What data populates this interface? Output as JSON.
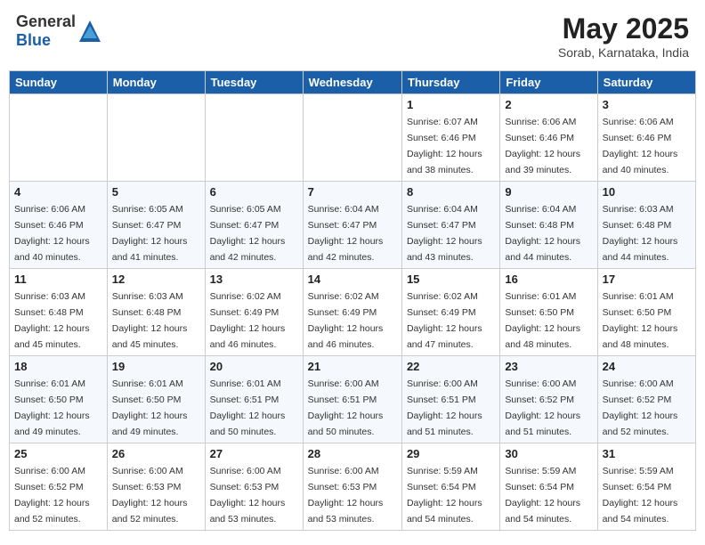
{
  "header": {
    "logo_general": "General",
    "logo_blue": "Blue",
    "month_year": "May 2025",
    "location": "Sorab, Karnataka, India"
  },
  "weekdays": [
    "Sunday",
    "Monday",
    "Tuesday",
    "Wednesday",
    "Thursday",
    "Friday",
    "Saturday"
  ],
  "weeks": [
    [
      {
        "day": "",
        "sunrise": "",
        "sunset": "",
        "daylight": ""
      },
      {
        "day": "",
        "sunrise": "",
        "sunset": "",
        "daylight": ""
      },
      {
        "day": "",
        "sunrise": "",
        "sunset": "",
        "daylight": ""
      },
      {
        "day": "",
        "sunrise": "",
        "sunset": "",
        "daylight": ""
      },
      {
        "day": "1",
        "sunrise": "Sunrise: 6:07 AM",
        "sunset": "Sunset: 6:46 PM",
        "daylight": "Daylight: 12 hours and 38 minutes."
      },
      {
        "day": "2",
        "sunrise": "Sunrise: 6:06 AM",
        "sunset": "Sunset: 6:46 PM",
        "daylight": "Daylight: 12 hours and 39 minutes."
      },
      {
        "day": "3",
        "sunrise": "Sunrise: 6:06 AM",
        "sunset": "Sunset: 6:46 PM",
        "daylight": "Daylight: 12 hours and 40 minutes."
      }
    ],
    [
      {
        "day": "4",
        "sunrise": "Sunrise: 6:06 AM",
        "sunset": "Sunset: 6:46 PM",
        "daylight": "Daylight: 12 hours and 40 minutes."
      },
      {
        "day": "5",
        "sunrise": "Sunrise: 6:05 AM",
        "sunset": "Sunset: 6:47 PM",
        "daylight": "Daylight: 12 hours and 41 minutes."
      },
      {
        "day": "6",
        "sunrise": "Sunrise: 6:05 AM",
        "sunset": "Sunset: 6:47 PM",
        "daylight": "Daylight: 12 hours and 42 minutes."
      },
      {
        "day": "7",
        "sunrise": "Sunrise: 6:04 AM",
        "sunset": "Sunset: 6:47 PM",
        "daylight": "Daylight: 12 hours and 42 minutes."
      },
      {
        "day": "8",
        "sunrise": "Sunrise: 6:04 AM",
        "sunset": "Sunset: 6:47 PM",
        "daylight": "Daylight: 12 hours and 43 minutes."
      },
      {
        "day": "9",
        "sunrise": "Sunrise: 6:04 AM",
        "sunset": "Sunset: 6:48 PM",
        "daylight": "Daylight: 12 hours and 44 minutes."
      },
      {
        "day": "10",
        "sunrise": "Sunrise: 6:03 AM",
        "sunset": "Sunset: 6:48 PM",
        "daylight": "Daylight: 12 hours and 44 minutes."
      }
    ],
    [
      {
        "day": "11",
        "sunrise": "Sunrise: 6:03 AM",
        "sunset": "Sunset: 6:48 PM",
        "daylight": "Daylight: 12 hours and 45 minutes."
      },
      {
        "day": "12",
        "sunrise": "Sunrise: 6:03 AM",
        "sunset": "Sunset: 6:48 PM",
        "daylight": "Daylight: 12 hours and 45 minutes."
      },
      {
        "day": "13",
        "sunrise": "Sunrise: 6:02 AM",
        "sunset": "Sunset: 6:49 PM",
        "daylight": "Daylight: 12 hours and 46 minutes."
      },
      {
        "day": "14",
        "sunrise": "Sunrise: 6:02 AM",
        "sunset": "Sunset: 6:49 PM",
        "daylight": "Daylight: 12 hours and 46 minutes."
      },
      {
        "day": "15",
        "sunrise": "Sunrise: 6:02 AM",
        "sunset": "Sunset: 6:49 PM",
        "daylight": "Daylight: 12 hours and 47 minutes."
      },
      {
        "day": "16",
        "sunrise": "Sunrise: 6:01 AM",
        "sunset": "Sunset: 6:50 PM",
        "daylight": "Daylight: 12 hours and 48 minutes."
      },
      {
        "day": "17",
        "sunrise": "Sunrise: 6:01 AM",
        "sunset": "Sunset: 6:50 PM",
        "daylight": "Daylight: 12 hours and 48 minutes."
      }
    ],
    [
      {
        "day": "18",
        "sunrise": "Sunrise: 6:01 AM",
        "sunset": "Sunset: 6:50 PM",
        "daylight": "Daylight: 12 hours and 49 minutes."
      },
      {
        "day": "19",
        "sunrise": "Sunrise: 6:01 AM",
        "sunset": "Sunset: 6:50 PM",
        "daylight": "Daylight: 12 hours and 49 minutes."
      },
      {
        "day": "20",
        "sunrise": "Sunrise: 6:01 AM",
        "sunset": "Sunset: 6:51 PM",
        "daylight": "Daylight: 12 hours and 50 minutes."
      },
      {
        "day": "21",
        "sunrise": "Sunrise: 6:00 AM",
        "sunset": "Sunset: 6:51 PM",
        "daylight": "Daylight: 12 hours and 50 minutes."
      },
      {
        "day": "22",
        "sunrise": "Sunrise: 6:00 AM",
        "sunset": "Sunset: 6:51 PM",
        "daylight": "Daylight: 12 hours and 51 minutes."
      },
      {
        "day": "23",
        "sunrise": "Sunrise: 6:00 AM",
        "sunset": "Sunset: 6:52 PM",
        "daylight": "Daylight: 12 hours and 51 minutes."
      },
      {
        "day": "24",
        "sunrise": "Sunrise: 6:00 AM",
        "sunset": "Sunset: 6:52 PM",
        "daylight": "Daylight: 12 hours and 52 minutes."
      }
    ],
    [
      {
        "day": "25",
        "sunrise": "Sunrise: 6:00 AM",
        "sunset": "Sunset: 6:52 PM",
        "daylight": "Daylight: 12 hours and 52 minutes."
      },
      {
        "day": "26",
        "sunrise": "Sunrise: 6:00 AM",
        "sunset": "Sunset: 6:53 PM",
        "daylight": "Daylight: 12 hours and 52 minutes."
      },
      {
        "day": "27",
        "sunrise": "Sunrise: 6:00 AM",
        "sunset": "Sunset: 6:53 PM",
        "daylight": "Daylight: 12 hours and 53 minutes."
      },
      {
        "day": "28",
        "sunrise": "Sunrise: 6:00 AM",
        "sunset": "Sunset: 6:53 PM",
        "daylight": "Daylight: 12 hours and 53 minutes."
      },
      {
        "day": "29",
        "sunrise": "Sunrise: 5:59 AM",
        "sunset": "Sunset: 6:54 PM",
        "daylight": "Daylight: 12 hours and 54 minutes."
      },
      {
        "day": "30",
        "sunrise": "Sunrise: 5:59 AM",
        "sunset": "Sunset: 6:54 PM",
        "daylight": "Daylight: 12 hours and 54 minutes."
      },
      {
        "day": "31",
        "sunrise": "Sunrise: 5:59 AM",
        "sunset": "Sunset: 6:54 PM",
        "daylight": "Daylight: 12 hours and 54 minutes."
      }
    ]
  ]
}
